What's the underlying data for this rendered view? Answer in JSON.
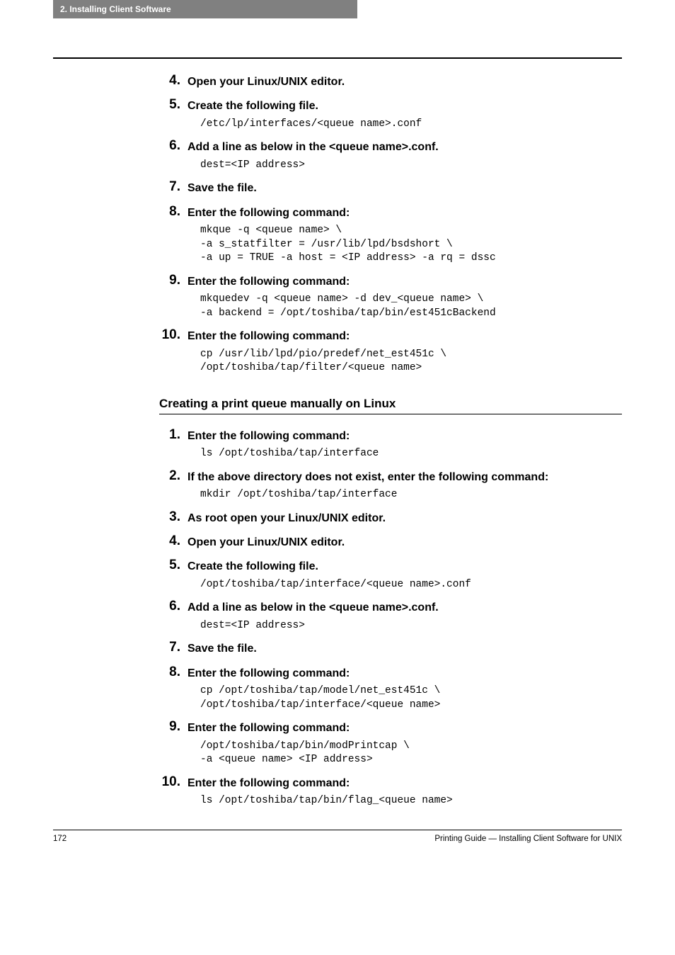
{
  "header": {
    "tab": "2. Installing Client Software"
  },
  "sectionA": {
    "steps": [
      {
        "num": "4.",
        "title": "Open your Linux/UNIX editor.",
        "code": ""
      },
      {
        "num": "5.",
        "title": "Create the following file.",
        "code": "/etc/lp/interfaces/<queue name>.conf"
      },
      {
        "num": "6.",
        "title": "Add a line as below in the <queue name>.conf.",
        "code": "dest=<IP address>"
      },
      {
        "num": "7.",
        "title": "Save the file.",
        "code": ""
      },
      {
        "num": "8.",
        "title": "Enter the following command:",
        "code": "mkque -q <queue name> \\\n-a s_statfilter = /usr/lib/lpd/bsdshort \\\n-a up = TRUE -a host = <IP address> -a rq = dssc"
      },
      {
        "num": "9.",
        "title": "Enter the following command:",
        "code": "mkquedev -q <queue name> -d dev_<queue name> \\\n-a backend = /opt/toshiba/tap/bin/est451cBackend"
      },
      {
        "num": "10.",
        "title": "Enter the following command:",
        "code": "cp /usr/lib/lpd/pio/predef/net_est451c \\\n/opt/toshiba/tap/filter/<queue name>"
      }
    ]
  },
  "sectionB": {
    "heading": "Creating a print queue manually on Linux",
    "steps": [
      {
        "num": "1.",
        "title": "Enter the following command:",
        "code": "ls /opt/toshiba/tap/interface"
      },
      {
        "num": "2.",
        "title": "If the above directory does not exist, enter the following command:",
        "code": "mkdir /opt/toshiba/tap/interface"
      },
      {
        "num": "3.",
        "title": "As root open  your Linux/UNIX editor.",
        "code": ""
      },
      {
        "num": "4.",
        "title": "Open your Linux/UNIX editor.",
        "code": ""
      },
      {
        "num": "5.",
        "title": "Create the following file.",
        "code": "/opt/toshiba/tap/interface/<queue name>.conf"
      },
      {
        "num": "6.",
        "title": "Add a line as below in the <queue name>.conf.",
        "code": "dest=<IP address>"
      },
      {
        "num": "7.",
        "title": "Save the file.",
        "code": ""
      },
      {
        "num": "8.",
        "title": "Enter the following command:",
        "code": "cp /opt/toshiba/tap/model/net_est451c \\\n/opt/toshiba/tap/interface/<queue name>"
      },
      {
        "num": "9.",
        "title": "Enter the following command:",
        "code": "/opt/toshiba/tap/bin/modPrintcap \\\n-a <queue name> <IP address>"
      },
      {
        "num": "10.",
        "title": "Enter the following command:",
        "code": "ls /opt/toshiba/tap/bin/flag_<queue name>"
      }
    ]
  },
  "footer": {
    "page": "172",
    "right": "Printing Guide — Installing Client Software for UNIX"
  }
}
